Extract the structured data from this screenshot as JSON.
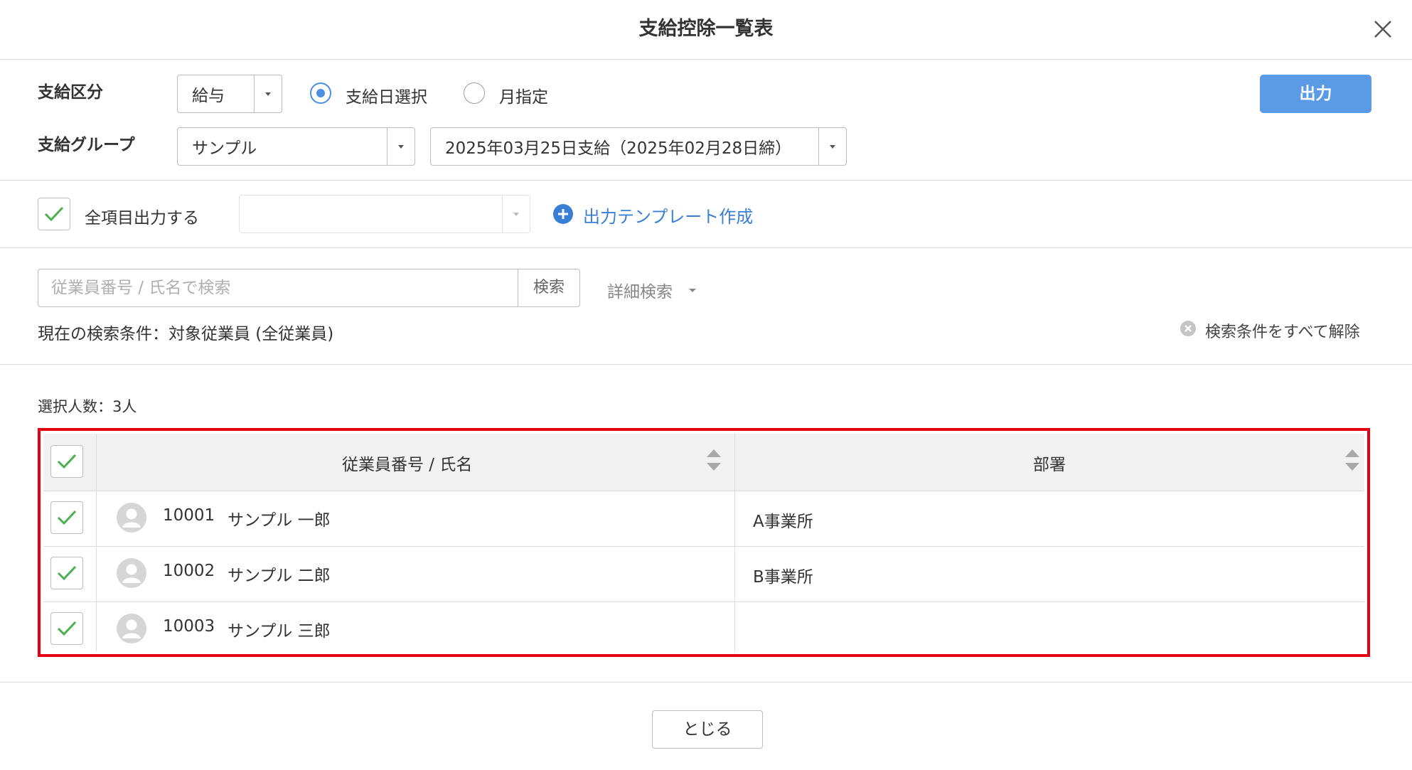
{
  "dialog": {
    "title": "支給控除一覧表"
  },
  "form": {
    "category_label": "支給区分",
    "category_value": "給与",
    "radio_paydate": "支給日選択",
    "radio_month": "月指定",
    "output_button": "出力",
    "group_label": "支給グループ",
    "group_value": "サンプル",
    "paydate_value": "2025年03月25日支給（2025年02月28日締）",
    "all_items_label": "全項目出力する",
    "template_link": "出力テンプレート作成"
  },
  "search": {
    "placeholder": "従業員番号 / 氏名で検索",
    "button": "検索",
    "advanced": "詳細検索",
    "conditions": "現在の検索条件：対象従業員 (全従業員)",
    "clear_all": "検索条件をすべて解除"
  },
  "table": {
    "selected_count": "選択人数：3人",
    "headers": {
      "employee": "従業員番号 / 氏名",
      "department": "部署"
    },
    "rows": [
      {
        "id": "10001",
        "name": "サンプル 一郎",
        "department": "A事業所"
      },
      {
        "id": "10002",
        "name": "サンプル 二郎",
        "department": "B事業所"
      },
      {
        "id": "10003",
        "name": "サンプル 三郎",
        "department": ""
      }
    ]
  },
  "footer": {
    "close_button": "とじる"
  },
  "colors": {
    "accent": "#4a90e2",
    "primary_button": "#5b9be6",
    "link": "#3a7fd5",
    "check": "#4caf50",
    "highlight_border": "#e60012"
  }
}
